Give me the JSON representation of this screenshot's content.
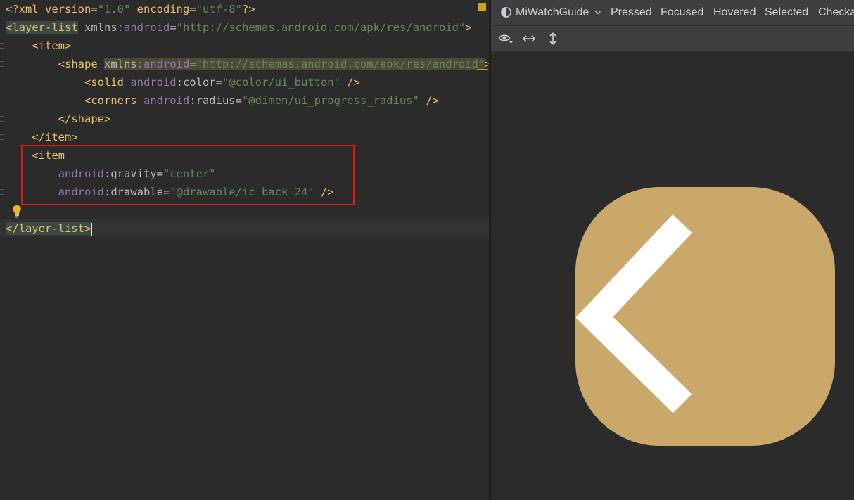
{
  "editor": {
    "lines": [
      {
        "id": "l1",
        "tokens": [
          [
            "pi",
            "<?xml version="
          ],
          [
            "val",
            "\"1.0\""
          ],
          [
            "pi",
            " encoding="
          ],
          [
            "val",
            "\"utf-8\""
          ],
          [
            "pi",
            "?>"
          ]
        ]
      },
      {
        "id": "l2",
        "tokens": [
          [
            "tag-hl",
            "<layer-list"
          ],
          [
            "attr",
            " "
          ],
          [
            "attr",
            "xmlns"
          ],
          [
            "ns",
            ":android"
          ],
          [
            "attr",
            "="
          ],
          [
            "val",
            "\"http://schemas.android.com/apk/res/android\""
          ],
          [
            "tag",
            ">"
          ]
        ]
      },
      {
        "id": "l3",
        "tokens": [
          [
            "attr",
            "    "
          ],
          [
            "tag",
            "<item>"
          ]
        ]
      },
      {
        "id": "l4",
        "tokens": [
          [
            "attr",
            "        "
          ],
          [
            "tag",
            "<shape "
          ],
          [
            "attr-hl",
            "xmlns"
          ],
          [
            "ns-hl",
            ":android"
          ],
          [
            "attr-hl",
            "="
          ],
          [
            "val-hl",
            "\"http://schemas.android.com/apk/res/android\""
          ],
          [
            "tag",
            ">"
          ]
        ]
      },
      {
        "id": "l5",
        "tokens": [
          [
            "attr",
            "            "
          ],
          [
            "tag",
            "<solid "
          ],
          [
            "ns",
            "android"
          ],
          [
            "attr",
            ":color="
          ],
          [
            "val",
            "\"@color/ui_button\""
          ],
          [
            "tag",
            " />"
          ]
        ]
      },
      {
        "id": "l6",
        "tokens": [
          [
            "attr",
            "            "
          ],
          [
            "tag",
            "<corners "
          ],
          [
            "ns",
            "android"
          ],
          [
            "attr",
            ":radius="
          ],
          [
            "val",
            "\"@dimen/ui_progress_radius\""
          ],
          [
            "tag",
            " />"
          ]
        ]
      },
      {
        "id": "l7",
        "tokens": [
          [
            "attr",
            "        "
          ],
          [
            "tag",
            "</shape>"
          ]
        ]
      },
      {
        "id": "l8",
        "tokens": [
          [
            "attr",
            "    "
          ],
          [
            "tag",
            "</item>"
          ]
        ]
      },
      {
        "id": "l9",
        "tokens": [
          [
            "attr",
            "    "
          ],
          [
            "tag",
            "<item"
          ]
        ]
      },
      {
        "id": "l10",
        "tokens": [
          [
            "attr",
            "        "
          ],
          [
            "ns",
            "android"
          ],
          [
            "attr",
            ":gravity="
          ],
          [
            "val",
            "\"center\""
          ]
        ]
      },
      {
        "id": "l11",
        "tokens": [
          [
            "attr",
            "        "
          ],
          [
            "ns",
            "android"
          ],
          [
            "attr",
            ":drawable="
          ],
          [
            "val",
            "\"@drawable/ic_back_24\""
          ],
          [
            "tag",
            " />"
          ]
        ]
      },
      {
        "id": "l12",
        "tokens": []
      },
      {
        "id": "l13",
        "tokens": [
          [
            "tag-hl",
            "</layer-list>"
          ]
        ]
      }
    ]
  },
  "preview": {
    "toolbar": {
      "device": "MiWatchGuide",
      "states": [
        "Pressed",
        "Focused",
        "Hovered",
        "Selected",
        "Checka"
      ]
    },
    "icons": {
      "theme": "contrast-circle-icon",
      "device_dropdown": "chevron-down-icon",
      "view": "eye-icon",
      "width": "horizontal-arrows-icon",
      "height": "vertical-arrows-icon"
    },
    "drawable": {
      "fill_color": "#c9a86a",
      "glyph_color": "#ffffff",
      "glyph": "chevron-left-icon"
    }
  },
  "colors": {
    "editor_bg": "#2b2b2b",
    "annotation_box": "#e01818",
    "bulb": "#e8b52a"
  }
}
